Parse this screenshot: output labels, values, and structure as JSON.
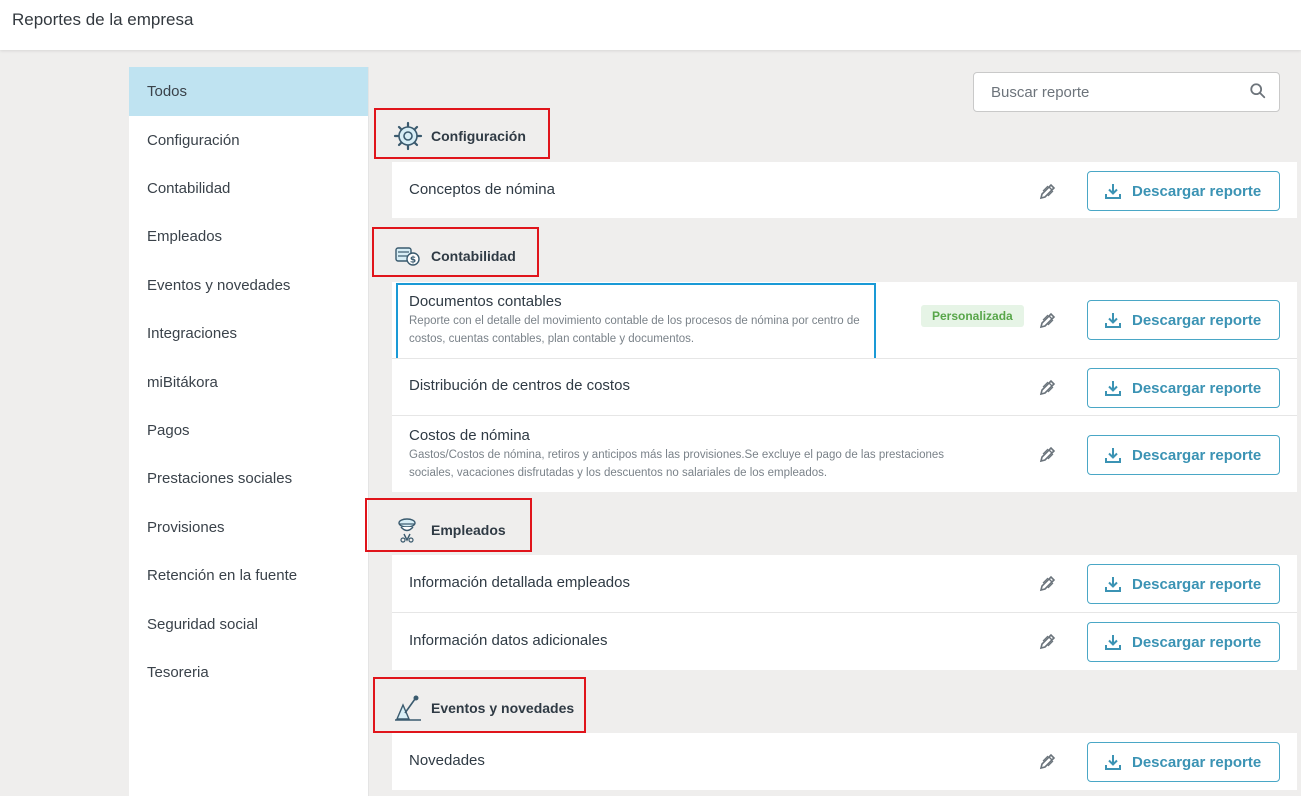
{
  "header": {
    "title": "Reportes de la empresa"
  },
  "sidebar": {
    "items": [
      {
        "label": "Todos"
      },
      {
        "label": "Configuración"
      },
      {
        "label": "Contabilidad"
      },
      {
        "label": "Empleados"
      },
      {
        "label": "Eventos y novedades"
      },
      {
        "label": "Integraciones"
      },
      {
        "label": "miBitákora"
      },
      {
        "label": "Pagos"
      },
      {
        "label": "Prestaciones sociales"
      },
      {
        "label": "Provisiones"
      },
      {
        "label": "Retención en la fuente"
      },
      {
        "label": "Seguridad social"
      },
      {
        "label": "Tesoreria"
      }
    ]
  },
  "search": {
    "placeholder": "Buscar reporte",
    "icon": "search-icon"
  },
  "sections": {
    "configuracion": {
      "title": "Configuración",
      "icon": "gear-icon",
      "reports": [
        {
          "title": "Conceptos de nómina"
        }
      ]
    },
    "contabilidad": {
      "title": "Contabilidad",
      "icon": "money-icon",
      "reports": [
        {
          "title": "Documentos contables",
          "description": "Reporte con el detalle del movimiento contable de los procesos de nómina por centro de costos, cuentas contables, plan contable y documentos.",
          "badge": "Personalizada"
        },
        {
          "title": "Distribución de centros de costos"
        },
        {
          "title": "Costos de nómina",
          "description": "Gastos/Costos de nómina, retiros y anticipos más las provisiones.Se excluye el pago de las prestaciones sociales, vacaciones disfrutadas y los descuentos no salariales de los empleados."
        }
      ]
    },
    "empleados": {
      "title": "Empleados",
      "icon": "employee-icon",
      "reports": [
        {
          "title": "Información detallada empleados"
        },
        {
          "title": "Información datos adicionales"
        }
      ]
    },
    "eventos": {
      "title": "Eventos y novedades",
      "icon": "events-icon",
      "reports": [
        {
          "title": "Novedades"
        }
      ]
    }
  },
  "download_label": "Descargar reporte",
  "colors": {
    "accent": "#3b93b4",
    "active_sidebar": "#bfe3f1",
    "highlight_red": "#e0141b",
    "highlight_blue": "#1a9ad6",
    "badge_green": "#58a64a"
  }
}
